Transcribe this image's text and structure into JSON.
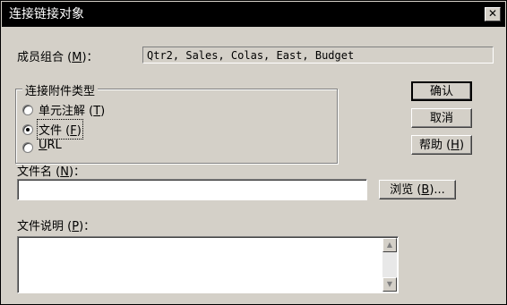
{
  "window": {
    "title": "连接链接对象",
    "close_glyph": "✕"
  },
  "member": {
    "label": "成员组合 ",
    "access": "M",
    "label_suffix": "：",
    "value": "Qtr2, Sales, Colas, East, Budget"
  },
  "attach": {
    "group_label": "连接附件类型",
    "options": [
      {
        "label": "单元注解 ",
        "access": "T",
        "selected": false
      },
      {
        "label": "文件 ",
        "access": "F",
        "selected": true
      },
      {
        "label": "",
        "access": "U",
        "rest": "RL",
        "selected": false
      }
    ]
  },
  "filename": {
    "label": "文件名 ",
    "access": "N",
    "label_suffix": "：",
    "value": ""
  },
  "browse": {
    "label": "浏览 ",
    "access": "B",
    "suffix": "..."
  },
  "desc": {
    "label": "文件说明 ",
    "access": "P",
    "label_suffix": "：",
    "value": ""
  },
  "buttons": {
    "ok": "确认",
    "cancel": "取消",
    "help": {
      "label": "帮助 ",
      "access": "H"
    }
  },
  "colors": {
    "face": "#d4d0c8",
    "titlebar": "#000000",
    "title_text": "#ffffff"
  },
  "icons": {
    "close": "close-icon",
    "scroll_up": "scroll-up-icon",
    "scroll_down": "scroll-down-icon"
  }
}
